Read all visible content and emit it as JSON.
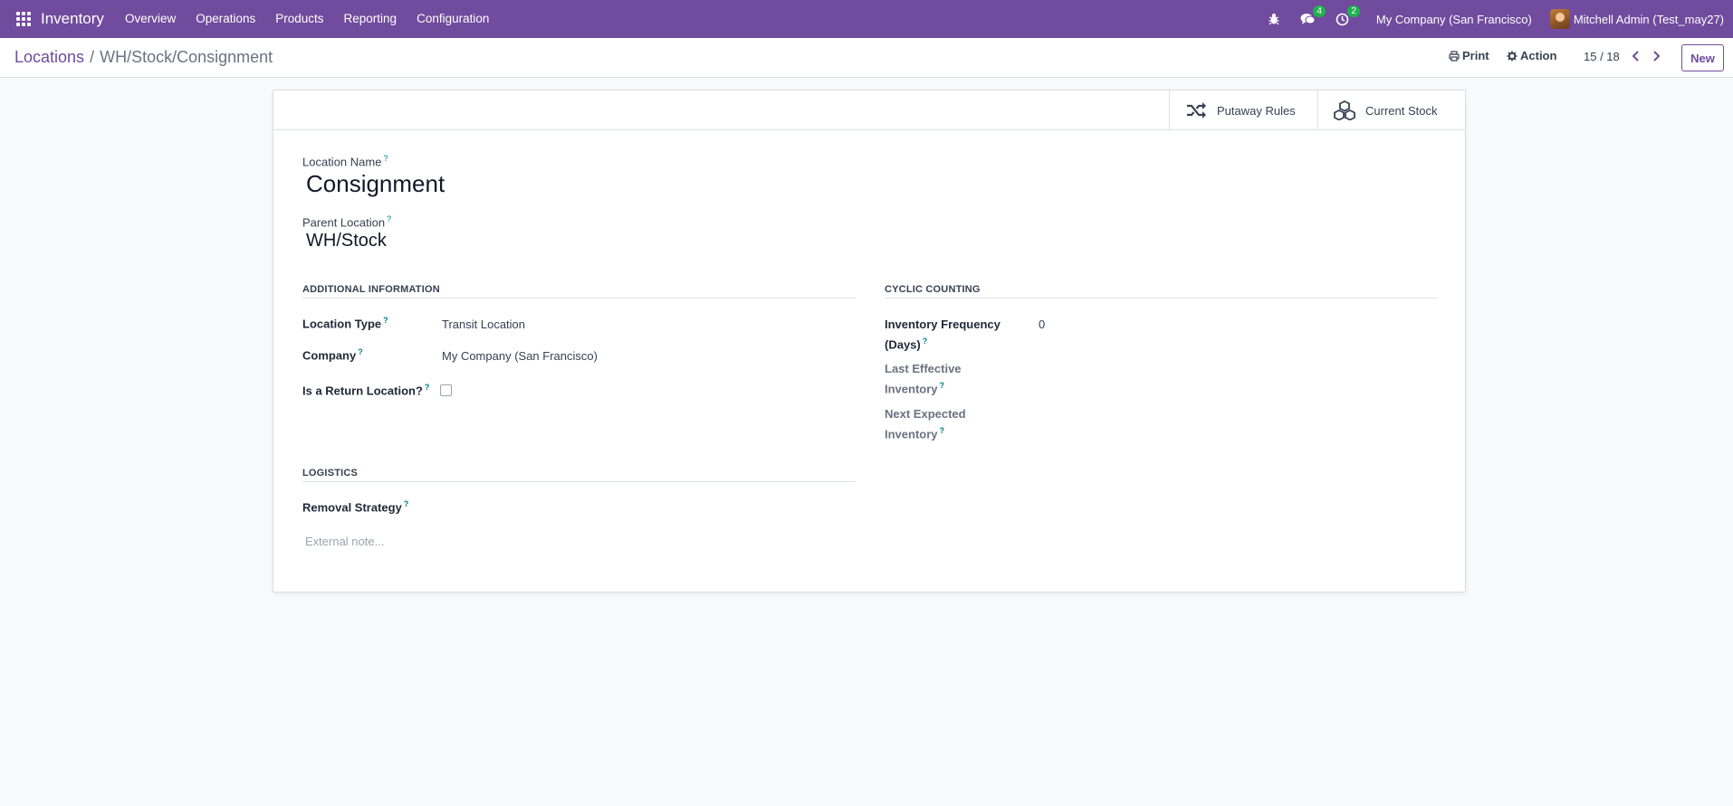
{
  "navbar": {
    "app_name": "Inventory",
    "menu": [
      "Overview",
      "Operations",
      "Products",
      "Reporting",
      "Configuration"
    ],
    "chat_count": "4",
    "activity_count": "2",
    "company": "My Company (San Francisco)",
    "user": "Mitchell Admin (Test_may27)",
    "accent_color": "#714b9e",
    "badge_color": "#1eb34f"
  },
  "control_panel": {
    "breadcrumb_parent": "Locations",
    "breadcrumb_separator": "/",
    "breadcrumb_current": "WH/Stock/Consignment",
    "print_label": "Print",
    "action_label": "Action",
    "pager": "15 / 18",
    "new_label": "New"
  },
  "smart_buttons": {
    "putaway": "Putaway Rules",
    "stock": "Current Stock"
  },
  "form": {
    "location_name_label": "Location Name",
    "location_name": "Consignment",
    "parent_location_label": "Parent Location",
    "parent_location": "WH/Stock",
    "help_mark": "?",
    "additional": {
      "title": "ADDITIONAL INFORMATION",
      "location_type_label": "Location Type",
      "location_type": "Transit Location",
      "company_label": "Company",
      "company": "My Company (San Francisco)",
      "return_label": "Is a Return Location?"
    },
    "cyclic": {
      "title": "CYCLIC COUNTING",
      "frequency_label_1": "Inventory Frequency",
      "frequency_label_2": "(Days)",
      "frequency": "0",
      "last_label_1": "Last Effective",
      "last_label_2": "Inventory",
      "next_label_1": "Next Expected",
      "next_label_2": "Inventory"
    },
    "logistics": {
      "title": "LOGISTICS",
      "removal_label": "Removal Strategy",
      "note_placeholder": "External note..."
    }
  }
}
